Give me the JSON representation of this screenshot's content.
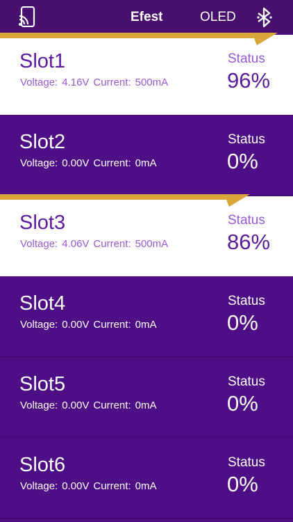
{
  "nav": {
    "tabs": [
      {
        "label": "Efest"
      },
      {
        "label": "OLED"
      }
    ],
    "cast_icon": "cast-screen-icon",
    "bluetooth_icon": "bluetooth-icon"
  },
  "labels": {
    "voltage": "Voltage:",
    "current": "Current:",
    "status": "Status"
  },
  "slots": [
    {
      "name": "Slot1",
      "voltage": "4.16V",
      "current": "500mA",
      "status": "96%",
      "charging": true
    },
    {
      "name": "Slot2",
      "voltage": "0.00V",
      "current": "0mA",
      "status": "0%",
      "charging": false
    },
    {
      "name": "Slot3",
      "voltage": "4.06V",
      "current": "500mA",
      "status": "86%",
      "charging": true
    },
    {
      "name": "Slot4",
      "voltage": "0.00V",
      "current": "0mA",
      "status": "0%",
      "charging": false
    },
    {
      "name": "Slot5",
      "voltage": "0.00V",
      "current": "0mA",
      "status": "0%",
      "charging": false
    },
    {
      "name": "Slot6",
      "voltage": "0.00V",
      "current": "0mA",
      "status": "0%",
      "charging": false
    }
  ],
  "colors": {
    "purple": "#4e0f86",
    "nav": "#47106f",
    "gold": "#d9a63a",
    "active_bg": "#ffffff",
    "active_text": "#5b1aa0",
    "active_subtext": "#9a58d6"
  }
}
